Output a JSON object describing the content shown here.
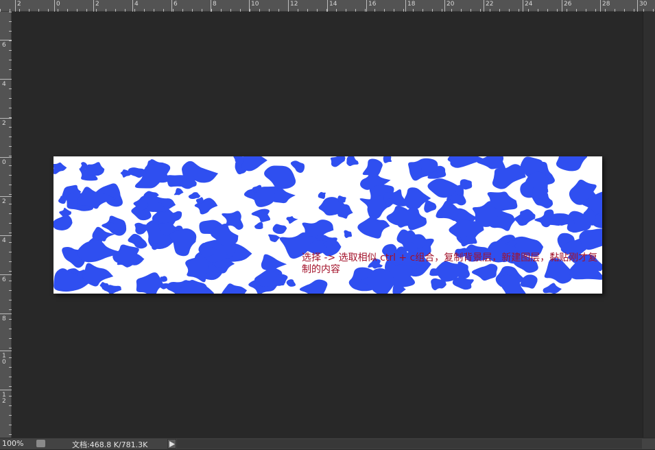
{
  "ruler_top": [
    "2",
    "0",
    "2",
    "4",
    "6",
    "8",
    "10",
    "12",
    "14",
    "16",
    "18",
    "20",
    "22",
    "24",
    "26",
    "28",
    "30"
  ],
  "ruler_left": [
    "6",
    "4",
    "2",
    "0",
    "2",
    "4",
    "6",
    "8",
    "10",
    "12"
  ],
  "annotation": "选择 -> 选取相似 ctrl + c组合，复制背景层，新建图层，黏贴刚才复制的内容",
  "colors": {
    "workspace": "#282828",
    "ruler": "#535353",
    "blob": "#2f4ff0",
    "image_bg": "#ffffff",
    "annotation": "#a3122a"
  },
  "status_bar": {
    "zoom": "100%",
    "doc_info": "文档:468.8 K/781.3K",
    "play_icon": "play-triangle-icon",
    "status_icon": "status-menu-icon"
  }
}
